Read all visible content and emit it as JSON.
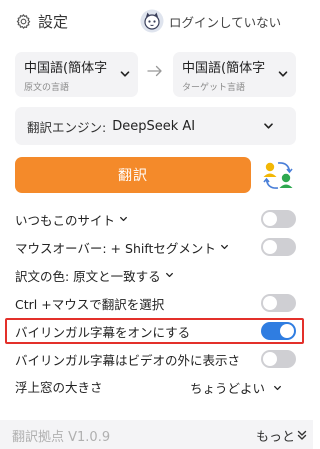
{
  "header": {
    "settings_label": "設定",
    "login_label": "ログインしていない"
  },
  "languages": {
    "source": {
      "value": "中国語(簡体字",
      "hint": "原文の言語"
    },
    "target": {
      "value": "中国語(簡体字",
      "hint": "ターゲット言語"
    }
  },
  "engine": {
    "label": "翻訳エンジン:",
    "value": "DeepSeek AI"
  },
  "translate_button": "翻訳",
  "options": {
    "always_site": {
      "label": "いつもこのサイト",
      "enabled": false
    },
    "mouseover": {
      "label": "マウスオーバー: + Shiftセグメント",
      "enabled": false
    },
    "color": {
      "label": "訳文の色: 原文と一致する"
    },
    "ctrl_mouse": {
      "label": "Ctrl +マウスで翻訳を選択",
      "enabled": false
    },
    "bilingual": {
      "label": "バイリンガル字幕をオンにする",
      "enabled": true
    },
    "bilingual_outside": {
      "label": "バイリンガル字幕はビデオの外に表示さ",
      "enabled": false
    },
    "float_size": {
      "label": "浮上窓の大きさ",
      "value": "ちょうどよい"
    }
  },
  "footer": {
    "version": "翻訳拠点 V1.0.9",
    "more": "もっと"
  },
  "colors": {
    "accent_orange": "#f48a2a",
    "toggle_on": "#2f7de1",
    "toggle_off": "#cfcfd3",
    "highlight": "#e3302a"
  }
}
